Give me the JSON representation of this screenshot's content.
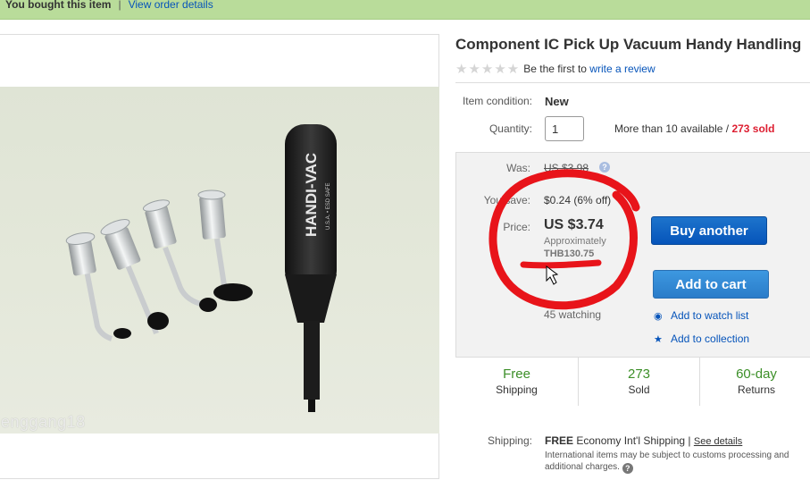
{
  "notice": {
    "text": "You bought this item",
    "separator": "|",
    "link": "View order details"
  },
  "image": {
    "watermark": "enggang18",
    "brand_marking": "HANDI-VAC",
    "origin_marking": "U.S.A. • ESD SAFE"
  },
  "item": {
    "title": "Component IC Pick Up Vacuum Handy Handling",
    "stars": "★★★★★",
    "rating_text": "Be the first to",
    "review_link": "write a review"
  },
  "condition": {
    "label": "Item condition:",
    "value": "New"
  },
  "quantity": {
    "label": "Quantity:",
    "value": "1",
    "availability": "More than 10 available /",
    "sold": "273 sold"
  },
  "pricing": {
    "was_label": "Was:",
    "was_value": "US $3.98",
    "help_icon": "?",
    "save_label": "You save:",
    "save_value": "$0.24 (6% off)",
    "price_label": "Price:",
    "price_value": "US $3.74",
    "approx_label": "Approximately",
    "approx_value": "THB130.75"
  },
  "actions": {
    "buy_another": "Buy another",
    "add_to_cart": "Add to cart",
    "watching": "45 watching",
    "watch_list": "Add to watch list",
    "collection": "Add to collection",
    "watch_icon": "eye-icon",
    "collection_icon": "star-icon"
  },
  "features": [
    {
      "big": "Free",
      "small": "Shipping"
    },
    {
      "big": "273",
      "small": "Sold"
    },
    {
      "big": "60-day",
      "small": "Returns"
    }
  ],
  "shipping": {
    "label": "Shipping:",
    "free": "FREE",
    "method": "Economy Int'l Shipping |",
    "details_link": "See details",
    "note": "International items may be subject to customs processing and additional charges."
  },
  "colors": {
    "notice_bg": "#b9dc9a",
    "link": "#0654ba",
    "buy_button": "#0654ba",
    "cart_button": "#2a7cc9",
    "sold_red": "#dd1e31",
    "feature_green": "#3c8f28",
    "annotation_red": "#e8141a"
  }
}
